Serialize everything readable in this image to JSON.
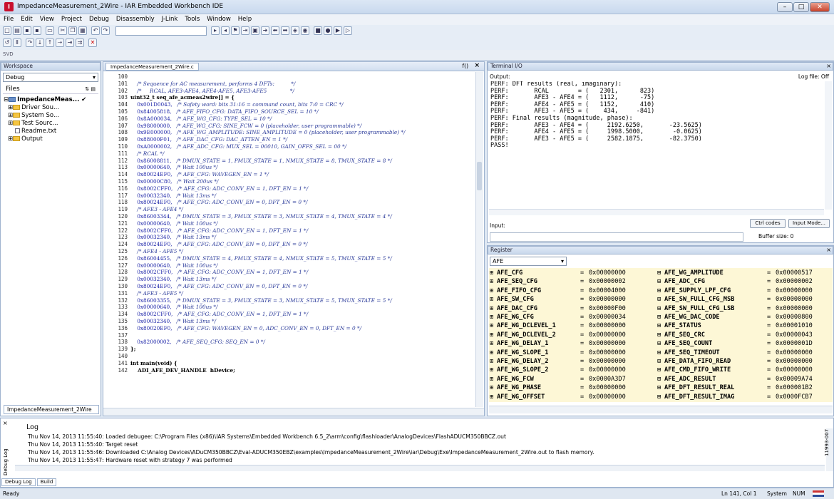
{
  "window": {
    "title": "ImpedanceMeasurement_2Wire - IAR Embedded Workbench IDE",
    "controls": [
      "–",
      "□",
      "✕"
    ]
  },
  "menu": [
    "File",
    "Edit",
    "View",
    "Project",
    "Debug",
    "Disassembly",
    "J-Link",
    "Tools",
    "Window",
    "Help"
  ],
  "toolbar3_label": "SVD",
  "workspace": {
    "header": "Workspace",
    "config": "Debug",
    "files_label": "Files",
    "tree": [
      "ImpedanceMeas...",
      "Driver Sou...",
      "System So...",
      "Test Sourc...",
      "Readme.txt",
      "Output"
    ],
    "tab": "ImpedanceMeasurement_2Wire"
  },
  "editor": {
    "tab": "ImpedanceMeasurement_2Wire.c",
    "function_btn": "f()",
    "lines": [
      {
        "n": "100",
        "code": []
      },
      {
        "n": "101",
        "code": [
          [
            "cm",
            "    /* Sequence for AC measurement, performs 4 DFTs:          */"
          ]
        ]
      },
      {
        "n": "102",
        "code": [
          [
            "cm",
            "    /*     RCAL, AFE3-AFE4, AFE4-AFE5, AFE3-AFE5              */"
          ]
        ]
      },
      {
        "n": "103",
        "code": [
          [
            "kw",
            "uint32_t seq_afe_acmeas2wire[] = {"
          ]
        ]
      },
      {
        "n": "104",
        "code": [
          [
            "hx",
            "    0x001D0043,"
          ],
          [
            "cm",
            "   /* Safety word: bits 31:16 = command count, bits 7:0 = CRC */"
          ]
        ]
      },
      {
        "n": "105",
        "code": [
          [
            "hx",
            "    0x84005818,"
          ],
          [
            "cm",
            "   /* AFE_FIFO_CFG: DATA_FIFO_SOURCE_SEL = 10 */"
          ]
        ]
      },
      {
        "n": "106",
        "code": [
          [
            "hx",
            "    0x8A000034,"
          ],
          [
            "cm",
            "   /* AFE_WG_CFG: TYPE_SEL = 10 */"
          ]
        ]
      },
      {
        "n": "107",
        "code": [
          [
            "hx",
            "    0x98000000,"
          ],
          [
            "cm",
            "   /* AFE_WG_CFG: SINE_FCW = 0 (placeholder, user programmable) */"
          ]
        ]
      },
      {
        "n": "108",
        "code": [
          [
            "hx",
            "    0x9E000000,"
          ],
          [
            "cm",
            "   /* AFE_WG_AMPLITUDE: SINE_AMPLITUDE = 0 (placeholder, user programmable) */"
          ]
        ]
      },
      {
        "n": "109",
        "code": [
          [
            "hx",
            "    0x88000F01,"
          ],
          [
            "cm",
            "   /* AFE_DAC_CFG: DAC_ATTEN_EN = 1 */"
          ]
        ]
      },
      {
        "n": "110",
        "code": [
          [
            "hx",
            "    0xA0000002,"
          ],
          [
            "cm",
            "   /* AFE_ADC_CFG: MUX_SEL = 00010, GAIN_OFFS_SEL = 00 */"
          ]
        ]
      },
      {
        "n": "111",
        "code": [
          [
            "cm",
            "    /* RCAL */"
          ]
        ]
      },
      {
        "n": "112",
        "code": [
          [
            "hx",
            "    0x86008811,"
          ],
          [
            "cm",
            "   /* DMUX_STATE = 1, PMUX_STATE = 1, NMUX_STATE = 8, TMUX_STATE = 8 */"
          ]
        ]
      },
      {
        "n": "113",
        "code": [
          [
            "hx",
            "    0x00000640,"
          ],
          [
            "cm",
            "   /* Wait 100us */"
          ]
        ]
      },
      {
        "n": "114",
        "code": [
          [
            "hx",
            "    0x80024EF0,"
          ],
          [
            "cm",
            "   /* AFE_CFG: WAVEGEN_EN = 1 */"
          ]
        ]
      },
      {
        "n": "115",
        "code": [
          [
            "hx",
            "    0x00000C80,"
          ],
          [
            "cm",
            "   /* Wait 200us */"
          ]
        ]
      },
      {
        "n": "116",
        "code": [
          [
            "hx",
            "    0x8002CFF0,"
          ],
          [
            "cm",
            "   /* AFE_CFG: ADC_CONV_EN = 1, DFT_EN = 1 */"
          ]
        ]
      },
      {
        "n": "117",
        "code": [
          [
            "hx",
            "    0x00032340,"
          ],
          [
            "cm",
            "   /* Wait 13ms */"
          ]
        ]
      },
      {
        "n": "118",
        "code": [
          [
            "hx",
            "    0x80024EF0,"
          ],
          [
            "cm",
            "   /* AFE_CFG: ADC_CONV_EN = 0, DFT_EN = 0 */"
          ]
        ]
      },
      {
        "n": "119",
        "code": [
          [
            "cm",
            "    /* AFE3 - AFE4 */"
          ]
        ]
      },
      {
        "n": "120",
        "code": [
          [
            "hx",
            "    0x86003344,"
          ],
          [
            "cm",
            "   /* DMUX_STATE = 3, PMUX_STATE = 3, NMUX_STATE = 4, TMUX_STATE = 4 */"
          ]
        ]
      },
      {
        "n": "121",
        "code": [
          [
            "hx",
            "    0x00000640,"
          ],
          [
            "cm",
            "   /* Wait 100us */"
          ]
        ]
      },
      {
        "n": "122",
        "code": [
          [
            "hx",
            "    0x8002CFF0,"
          ],
          [
            "cm",
            "   /* AFE_CFG: ADC_CONV_EN = 1, DFT_EN = 1 */"
          ]
        ]
      },
      {
        "n": "123",
        "code": [
          [
            "hx",
            "    0x00032340,"
          ],
          [
            "cm",
            "   /* Wait 13ms */"
          ]
        ]
      },
      {
        "n": "124",
        "code": [
          [
            "hx",
            "    0x80024EF0,"
          ],
          [
            "cm",
            "   /* AFE_CFG: ADC_CONV_EN = 0, DFT_EN = 0 */"
          ]
        ]
      },
      {
        "n": "125",
        "code": [
          [
            "cm",
            "    /* AFE4 - AFE5 */"
          ]
        ]
      },
      {
        "n": "126",
        "code": [
          [
            "hx",
            "    0x86004455,"
          ],
          [
            "cm",
            "   /* DMUX_STATE = 4, PMUX_STATE = 4, NMUX_STATE = 5, TMUX_STATE = 5 */"
          ]
        ]
      },
      {
        "n": "127",
        "code": [
          [
            "hx",
            "    0x00000640,"
          ],
          [
            "cm",
            "   /* Wait 100us */"
          ]
        ]
      },
      {
        "n": "128",
        "code": [
          [
            "hx",
            "    0x8002CFF0,"
          ],
          [
            "cm",
            "   /* AFE_CFG: ADC_CONV_EN = 1, DFT_EN = 1 */"
          ]
        ]
      },
      {
        "n": "129",
        "code": [
          [
            "hx",
            "    0x00032340,"
          ],
          [
            "cm",
            "   /* Wait 13ms */"
          ]
        ]
      },
      {
        "n": "130",
        "code": [
          [
            "hx",
            "    0x80024EF0,"
          ],
          [
            "cm",
            "   /* AFE_CFG: ADC_CONV_EN = 0, DFT_EN = 0 */"
          ]
        ]
      },
      {
        "n": "131",
        "code": [
          [
            "cm",
            "    /* AFE3 - AFE5 */"
          ]
        ]
      },
      {
        "n": "132",
        "code": [
          [
            "hx",
            "    0x86003355,"
          ],
          [
            "cm",
            "   /* DMUX_STATE = 3, PMUX_STATE = 3, NMUX_STATE = 5, TMUX_STATE = 5 */"
          ]
        ]
      },
      {
        "n": "133",
        "code": [
          [
            "hx",
            "    0x00000640,"
          ],
          [
            "cm",
            "   /* Wait 100us */"
          ]
        ]
      },
      {
        "n": "134",
        "code": [
          [
            "hx",
            "    0x8002CFF0,"
          ],
          [
            "cm",
            "   /* AFE_CFG: ADC_CONV_EN = 1, DFT_EN = 1 */"
          ]
        ]
      },
      {
        "n": "135",
        "code": [
          [
            "hx",
            "    0x00032340,"
          ],
          [
            "cm",
            "   /* Wait 13ms */"
          ]
        ]
      },
      {
        "n": "136",
        "code": [
          [
            "hx",
            "    0x80020EF0,"
          ],
          [
            "cm",
            "   /* AFE_CFG: WAVEGEN_EN = 0, ADC_CONV_EN = 0, DFT_EN = 0 */"
          ]
        ]
      },
      {
        "n": "137",
        "code": []
      },
      {
        "n": "138",
        "code": [
          [
            "hx",
            "    0x82000002,"
          ],
          [
            "cm",
            "   /* AFE_SEQ_CFG: SEQ_EN = 0 */"
          ]
        ]
      },
      {
        "n": "139",
        "code": [
          [
            "kw",
            "};"
          ]
        ]
      },
      {
        "n": "140",
        "code": []
      },
      {
        "n": "141",
        "code": [
          [
            "kw",
            "int main(void) {"
          ]
        ]
      },
      {
        "n": "142",
        "code": [
          [
            "kw",
            "    ADI_AFE_DEV_HANDLE  hDevice;"
          ]
        ]
      }
    ]
  },
  "terminal": {
    "header": "Terminal I/O",
    "output_label": "Output:",
    "log_file": "Log file: Off",
    "output": "PERF: DFT results (real, imaginary):\nPERF:       RCAL        = (   2301,      823)\nPERF:       AFE3 - AFE4 = (   1112,      -75)\nPERF:       AFE4 - AFE5 = (   1152,      410)\nPERF:       AFE3 - AFE5 = (    434,     -841)\nPERF: Final results (magnitude, phase):\nPERF:       AFE3 - AFE4 = (     2192.6250,       -23.5625)\nPERF:       AFE4 - AFE5 = (     1998.5000,        -0.0625)\nPERF:       AFE3 - AFE5 = (     2582.1875,       -82.3750)\nPASS!",
    "input_label": "Input:",
    "ctrl_codes": "Ctrl codes",
    "input_mode": "Input Mode...",
    "buffer_size": "Buffer size:    0"
  },
  "register": {
    "header": "Register",
    "group": "AFE",
    "rows": [
      [
        "AFE_CFG",
        "0x00000000",
        "AFE_WG_AMPLITUDE",
        "0x00000517"
      ],
      [
        "AFE_SEQ_CFG",
        "0x00000002",
        "AFE_ADC_CFG",
        "0x00000002"
      ],
      [
        "AFE_FIFO_CFG",
        "0x00004000",
        "AFE_SUPPLY_LPF_CFG",
        "0x00000000"
      ],
      [
        "AFE_SW_CFG",
        "0x00000000",
        "AFE_SW_FULL_CFG_MSB",
        "0x00000000"
      ],
      [
        "AFE_DAC_CFG",
        "0x00000F00",
        "AFE_SW_FULL_CFG_LSB",
        "0x00000000"
      ],
      [
        "AFE_WG_CFG",
        "0x00000034",
        "AFE_WG_DAC_CODE",
        "0x00000800"
      ],
      [
        "AFE_WG_DCLEVEL_1",
        "0x00000000",
        "AFE_STATUS",
        "0x00001010"
      ],
      [
        "AFE_WG_DCLEVEL_2",
        "0x00000000",
        "AFE_SEQ_CRC",
        "0x00000043"
      ],
      [
        "AFE_WG_DELAY_1",
        "0x00000000",
        "AFE_SEQ_COUNT",
        "0x0000001D"
      ],
      [
        "AFE_WG_SLOPE_1",
        "0x00000000",
        "AFE_SEQ_TIMEOUT",
        "0x00000000"
      ],
      [
        "AFE_WG_DELAY_2",
        "0x00000000",
        "AFE_DATA_FIFO_READ",
        "0x00000000"
      ],
      [
        "AFE_WG_SLOPE_2",
        "0x00000000",
        "AFE_CMD_FIFO_WRITE",
        "0x00000000"
      ],
      [
        "AFE_WG_FCW",
        "0x0000A3D7",
        "AFE_ADC_RESULT",
        "0x00009A74"
      ],
      [
        "AFE_WG_PHASE",
        "0x00000000",
        "AFE_DFT_RESULT_REAL",
        "0x000001B2"
      ],
      [
        "AFE_WG_OFFSET",
        "0x00000000",
        "AFE_DFT_RESULT_IMAG",
        "0x0000FCB7"
      ]
    ]
  },
  "debug_log": {
    "title": "Log",
    "side_label": "Debug Log",
    "lines": [
      "Thu Nov 14, 2013 11:55:40: Loaded debugee: C:\\Program Files (x86)\\IAR Systems\\Embedded Workbench 6.5_2\\arm\\config\\flashloader\\AnalogDevices\\FlashADUCM350BBCZ.out",
      "Thu Nov 14, 2013 11:55:40: Target reset",
      "Thu Nov 14, 2013 11:55:46: Downloaded C:\\Analog Devices\\ADuCM350BBCZ\\Eval-ADUCM350EBZ\\examples\\ImpedanceMeasurement_2Wire\\iar\\Debug\\Exe\\ImpedanceMeasurement_2Wire.out to flash memory.",
      "Thu Nov 14, 2013 11:55:47: Hardware reset with strategy 7 was performed"
    ],
    "tabs": [
      "Debug Log",
      "Build"
    ]
  },
  "status": {
    "left": "Ready",
    "position": "Ln 141, Col 1",
    "mode": "System",
    "num": "NUM"
  },
  "figure_id": "11993-007"
}
